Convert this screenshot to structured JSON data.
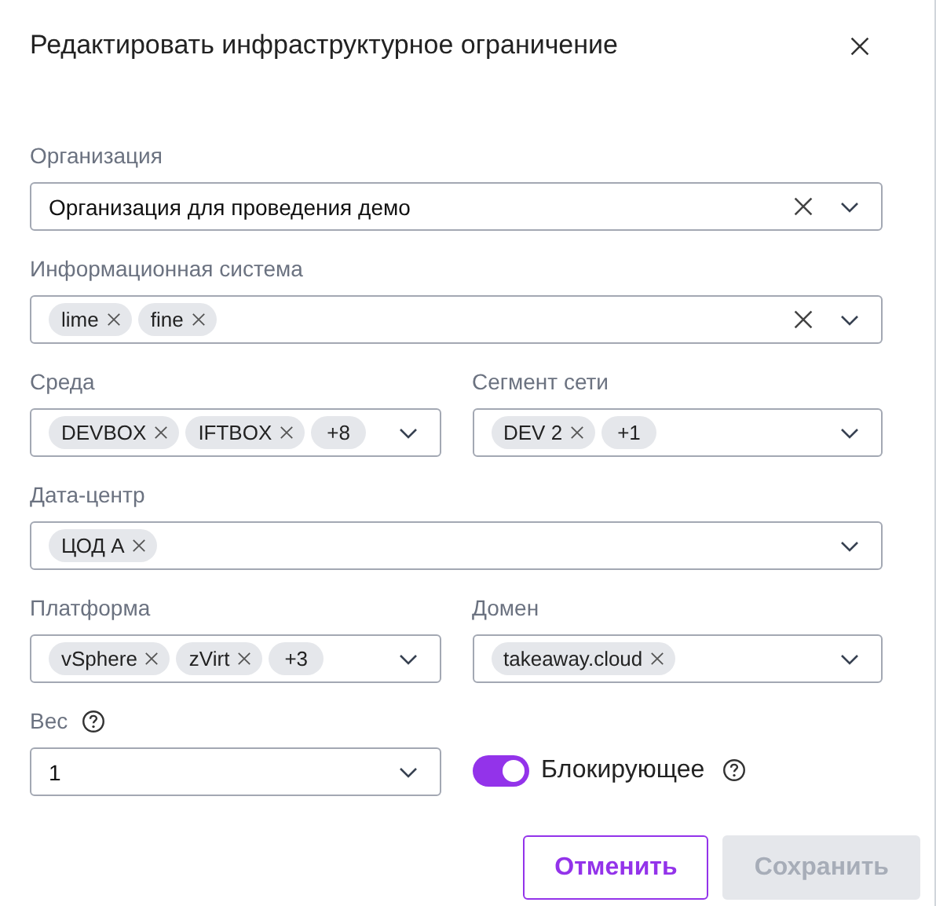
{
  "dialog": {
    "title": "Редактировать инфраструктурное ограничение",
    "close": true
  },
  "rows": [
    [
      {
        "kind": "select",
        "label": "Организация",
        "value": "Организация для проведения демо",
        "clearable": true
      }
    ],
    [
      {
        "kind": "multiselect",
        "label": "Информационная система",
        "tags": [
          "lime",
          "fine"
        ],
        "clearable": true
      }
    ],
    [
      {
        "kind": "multiselect",
        "label": "Среда",
        "tags": [
          "DEVBOX",
          "IFTBOX"
        ],
        "more": "+8",
        "clearable": false
      },
      {
        "kind": "multiselect",
        "label": "Сегмент сети",
        "tags": [
          "DEV 2"
        ],
        "more": "+1",
        "clearable": false
      }
    ],
    [
      {
        "kind": "multiselect",
        "label": "Дата-центр",
        "tags": [
          "ЦОД А"
        ],
        "clearable": false
      }
    ],
    [
      {
        "kind": "multiselect",
        "label": "Платформа",
        "tags": [
          "vSphere",
          "zVirt"
        ],
        "more": "+3",
        "clearable": false
      },
      {
        "kind": "multiselect",
        "label": "Домен",
        "tags": [
          "takeaway.cloud"
        ],
        "clearable": false
      }
    ],
    [
      {
        "kind": "select",
        "label": "Вес",
        "value": "1",
        "help": true,
        "clearable": false
      },
      {
        "kind": "toggle",
        "label": "Блокирующее",
        "on": true,
        "help": true
      }
    ]
  ],
  "buttons": [
    {
      "kind": "secondary",
      "label": "Отменить",
      "disabled": false
    },
    {
      "kind": "primary",
      "label": "Сохранить",
      "disabled": true
    }
  ]
}
